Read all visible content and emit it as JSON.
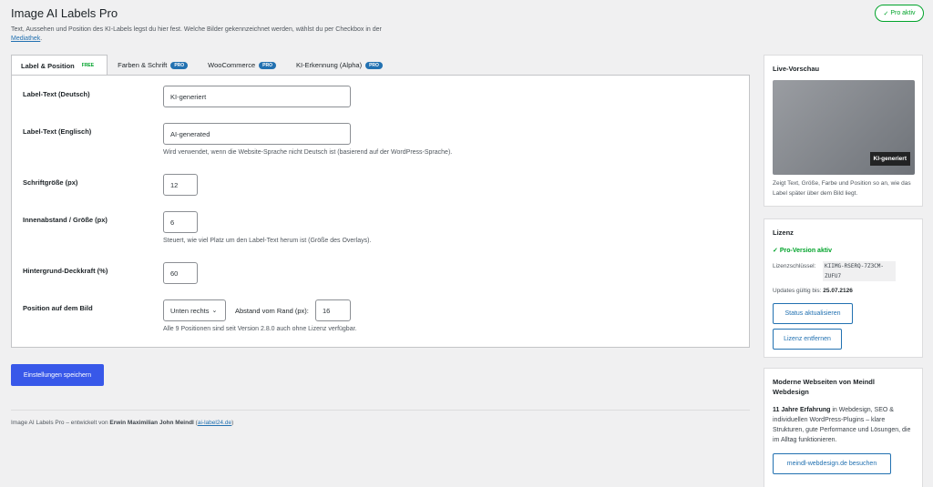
{
  "header": {
    "title": "Image AI Labels Pro",
    "subtitle": "Text, Aussehen und Position des KI-Labels legst du hier fest. Welche Bilder gekennzeichnet werden, wählst du per Checkbox in der ",
    "subtitle_link": "Mediathek",
    "subtitle_end": ".",
    "status_badge": "Pro aktiv"
  },
  "tabs": [
    {
      "label": "Label & Position",
      "badge": "FREE"
    },
    {
      "label": "Farben & Schrift",
      "badge": "PRO"
    },
    {
      "label": "WooCommerce",
      "badge": "PRO"
    },
    {
      "label": "KI-Erkennung (Alpha)",
      "badge": "PRO"
    }
  ],
  "form": {
    "label_de": {
      "label": "Label-Text (Deutsch)",
      "value": "KI-generiert"
    },
    "label_en": {
      "label": "Label-Text (Englisch)",
      "value": "AI-generated",
      "help": "Wird verwendet, wenn die Website-Sprache nicht Deutsch ist (basierend auf der WordPress-Sprache)."
    },
    "font_size": {
      "label": "Schriftgröße (px)",
      "value": "12"
    },
    "padding": {
      "label": "Innenabstand / Größe (px)",
      "value": "6",
      "help": "Steuert, wie viel Platz um den Label-Text herum ist (Größe des Overlays)."
    },
    "opacity": {
      "label": "Hintergrund-Deckkraft (%)",
      "value": "60"
    },
    "position": {
      "label": "Position auf dem Bild",
      "select_value": "Unten rechts",
      "distance_label": "Abstand vom Rand (px):",
      "distance_value": "16",
      "help": "Alle 9 Positionen sind seit Version 2.8.0 auch ohne Lizenz verfügbar."
    }
  },
  "save_label": "Einstellungen speichern",
  "footer": {
    "prefix": "Image AI Labels Pro – entwickelt von ",
    "author": "Erwin Maximilian John Meindl",
    "link": "ai-label24.de"
  },
  "preview": {
    "title": "Live-Vorschau",
    "label": "KI-generiert",
    "caption": "Zeigt Text, Größe, Farbe und Position so an, wie das Label später über dem Bild liegt."
  },
  "license": {
    "title": "Lizenz",
    "status": "Pro-Version aktiv",
    "key_label": "Lizenzschlüssel:",
    "key_value": "KIIMG-RSERQ-7Z3CM-ZUFU7",
    "updates_label": "Updates gültig bis:",
    "updates_value": "25.07.2126",
    "refresh_button": "Status aktualisieren",
    "remove_button": "Lizenz entfernen"
  },
  "meindl": {
    "title": "Moderne Webseiten von Meindl Webdesign",
    "text_bold": "11 Jahre Erfahrung",
    "text": " in Webdesign, SEO & individuellen WordPress-Plugins – klare Strukturen, gute Performance und Lösungen, die im Alltag funktionieren.",
    "button": "meindl-webdesign.de besuchen"
  },
  "colors": {
    "accent": "#2271b1",
    "save": "#3858e9",
    "success": "#00a32a"
  },
  "icons": {
    "check": "check-icon",
    "chevron": "chevron-down-icon"
  }
}
